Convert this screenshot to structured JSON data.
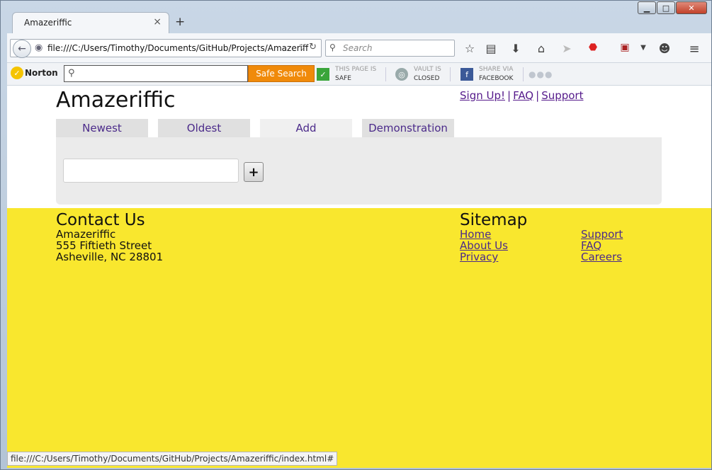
{
  "browser": {
    "tab_title": "Amazeriffic",
    "tab_close": "×",
    "new_tab": "+",
    "url": "file:///C:/Users/Timothy/Documents/GitHub/Projects/Amazeriff",
    "search_placeholder": "Search"
  },
  "norton": {
    "brand": "Norton",
    "search_button": "Safe Search",
    "page_status": {
      "line1": "THIS PAGE IS",
      "line2": "SAFE"
    },
    "vault_status": {
      "line1": "VAULT IS",
      "line2": "CLOSED"
    },
    "share": {
      "line1": "SHARE VIA",
      "line2": "FACEBOOK"
    }
  },
  "page": {
    "title": "Amazeriffic",
    "top_links": [
      "Sign Up!",
      "FAQ",
      "Support"
    ],
    "tabs": [
      "Newest",
      "Oldest",
      "Add",
      "Demonstration"
    ],
    "active_tab": "Add",
    "add_button": "+",
    "add_input_value": ""
  },
  "footer": {
    "contact_heading": "Contact Us",
    "contact_lines": [
      "Amazeriffic",
      "555 Fiftieth Street",
      "Asheville, NC 28801"
    ],
    "sitemap_heading": "Sitemap",
    "sitemap_col1": [
      "Home",
      "About Us",
      "Privacy"
    ],
    "sitemap_col2": [
      "Support",
      "FAQ",
      "Careers"
    ]
  },
  "status_bar": "file:///C:/Users/Timothy/Documents/GitHub/Projects/Amazeriffic/index.html#",
  "colors": {
    "footer_bg": "#f9e72e",
    "link": "#551a8b",
    "norton_orange": "#f08a0a"
  }
}
